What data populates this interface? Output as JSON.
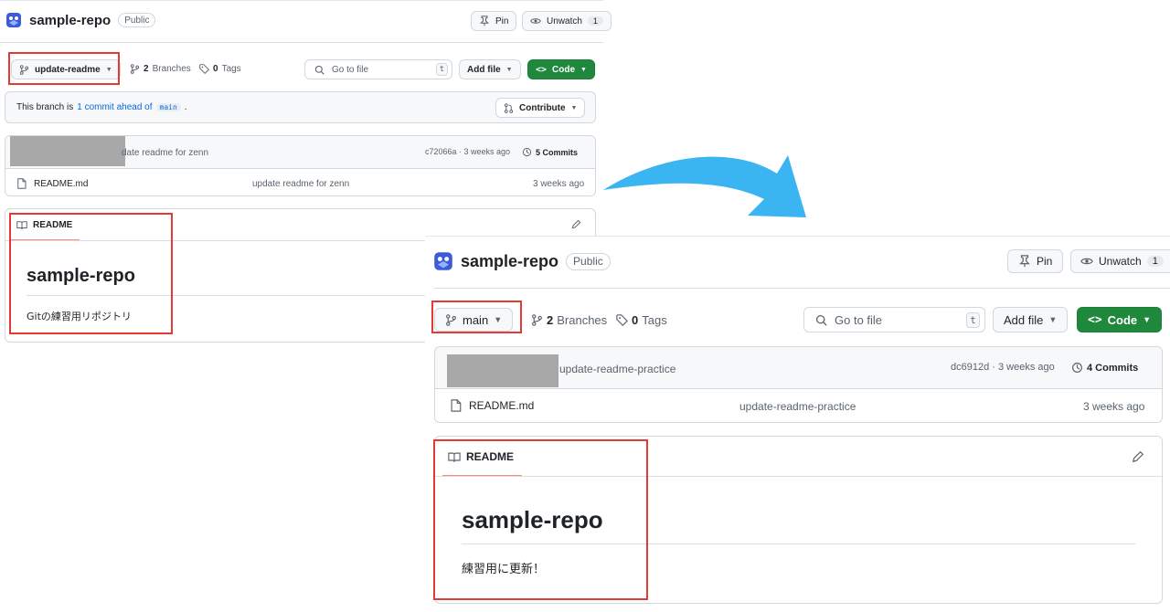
{
  "before": {
    "repo_name": "sample-repo",
    "visibility": "Public",
    "pin_label": "Pin",
    "unwatch_label": "Unwatch",
    "watch_count": "1",
    "branch": "update-readme",
    "branches_count": "2",
    "branches_label": "Branches",
    "tags_count": "0",
    "tags_label": "Tags",
    "search_placeholder": "Go to file",
    "search_shortcut": "t",
    "add_file_label": "Add file",
    "code_label": "Code",
    "banner": {
      "prefix": "This branch is",
      "link": "1 commit ahead of",
      "base": "main",
      "suffix": "."
    },
    "contribute_label": "Contribute",
    "latest_commit": {
      "message": "date readme for zenn",
      "hash_time": "c72066a · 3 weeks ago",
      "commits_label": "5 Commits"
    },
    "files": [
      {
        "name": "README.md",
        "message": "update readme for zenn",
        "time": "3 weeks ago"
      }
    ],
    "readme": {
      "tab": "README",
      "heading": "sample-repo",
      "body": "Gitの練習用リポジトリ"
    }
  },
  "after": {
    "repo_name": "sample-repo",
    "visibility": "Public",
    "pin_label": "Pin",
    "unwatch_label": "Unwatch",
    "watch_count": "1",
    "branch": "main",
    "branches_count": "2",
    "branches_label": "Branches",
    "tags_count": "0",
    "tags_label": "Tags",
    "search_placeholder": "Go to file",
    "search_shortcut": "t",
    "add_file_label": "Add file",
    "code_label": "Code",
    "latest_commit": {
      "message": "update-readme-practice",
      "hash_time": "dc6912d · 3 weeks ago",
      "commits_label": "4 Commits"
    },
    "files": [
      {
        "name": "README.md",
        "message": "update-readme-practice",
        "time": "3 weeks ago"
      }
    ],
    "readme": {
      "tab": "README",
      "heading": "sample-repo",
      "body": "練習用に更新！"
    }
  },
  "icons": {
    "logo": "octocat-logo-icon",
    "pin": "pin-icon",
    "eye": "eye-icon",
    "branch": "git-branch-icon",
    "tag": "tag-icon",
    "search": "search-icon",
    "code": "code-icon",
    "pull_request": "git-pull-request-icon",
    "history": "history-icon",
    "file": "file-icon",
    "book": "book-icon",
    "pencil": "pencil-icon",
    "arrow": "curved-arrow-icon"
  },
  "colors": {
    "accent_green": "#1f883d",
    "link_blue": "#0969da",
    "highlight_red": "#e53935",
    "arrow_blue": "#3bb4f2",
    "tab_underline": "#fd8c73"
  }
}
